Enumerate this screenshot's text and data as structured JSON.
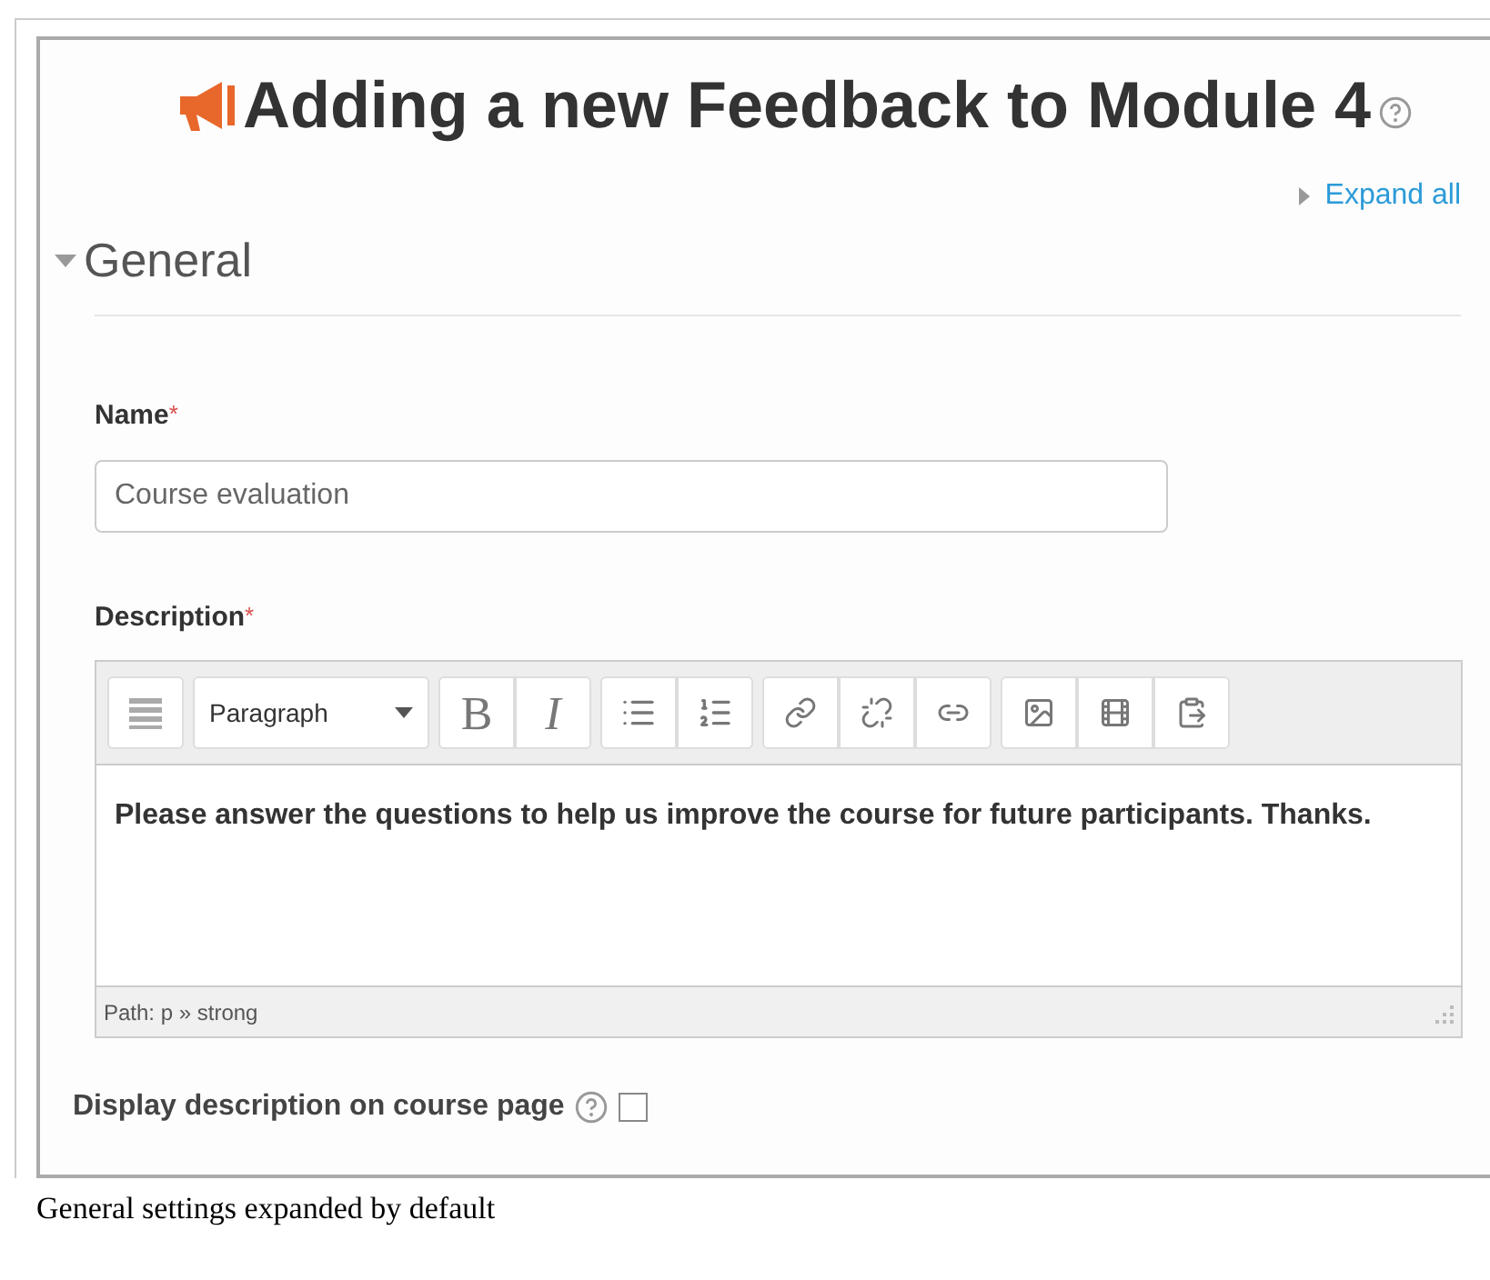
{
  "page": {
    "title": "Adding a new Feedback to Module 4"
  },
  "expand_all": {
    "label": "Expand all"
  },
  "section": {
    "title": "General",
    "expanded": true
  },
  "name_field": {
    "label": "Name",
    "required_mark": "*",
    "value": "Course evaluation"
  },
  "description": {
    "label": "Description",
    "required_mark": "*",
    "toolbar": {
      "format": "Paragraph",
      "bold": "B",
      "italic": "I"
    },
    "content": "Please answer the questions to help us improve the course for future participants. Thanks.",
    "path": "Path: p » strong"
  },
  "display_option": {
    "label": "Display description on course page",
    "checked": false
  },
  "caption": "General settings expanded by default"
}
